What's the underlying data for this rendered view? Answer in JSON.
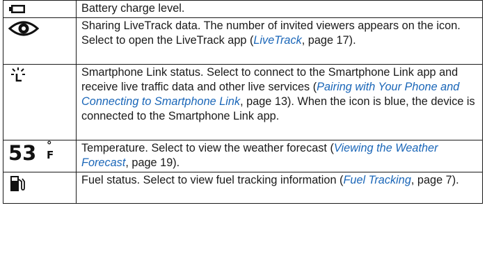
{
  "rows": [
    {
      "icon_name": "battery-icon",
      "segments": [
        {
          "type": "text",
          "text": "Battery charge level."
        }
      ]
    },
    {
      "icon_name": "livetrack-eye-icon",
      "segments": [
        {
          "type": "text",
          "text": "Sharing LiveTrack data. The number of invited viewers appears on the icon. Select to open the LiveTrack app ("
        },
        {
          "type": "link",
          "text": "LiveTrack"
        },
        {
          "type": "text",
          "text": ", page 17)."
        }
      ]
    },
    {
      "icon_name": "smartphone-link-icon",
      "segments": [
        {
          "type": "text",
          "text": "Smartphone Link status. Select to connect to the Smartphone Link app and receive live traffic data and other live services ("
        },
        {
          "type": "link",
          "text": "Pairing with Your Phone and Connecting to Smartphone Link"
        },
        {
          "type": "text",
          "text": ", page 13). When the icon is blue, the device is connected to the Smartphone Link app."
        }
      ]
    },
    {
      "icon_name": "temperature-icon",
      "icon_value": "53",
      "icon_degree": "°",
      "icon_unit": "F",
      "segments": [
        {
          "type": "text",
          "text": "Temperature. Select to view the weather forecast ("
        },
        {
          "type": "link",
          "text": "Viewing the Weather Forecast"
        },
        {
          "type": "text",
          "text": ", page 19)."
        }
      ]
    },
    {
      "icon_name": "fuel-pump-icon",
      "segments": [
        {
          "type": "text",
          "text": "Fuel status. Select to view fuel tracking information ("
        },
        {
          "type": "link",
          "text": "Fuel Tracking"
        },
        {
          "type": "text",
          "text": ", page 7)."
        }
      ]
    }
  ],
  "colors": {
    "text": "#1a1a1a",
    "link": "#1a66b8",
    "border": "#1a1a1a"
  }
}
